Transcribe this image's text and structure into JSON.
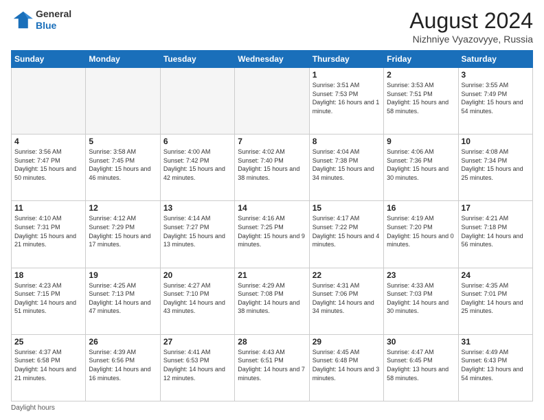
{
  "header": {
    "logo_general": "General",
    "logo_blue": "Blue",
    "month_year": "August 2024",
    "location": "Nizhniye Vyazovyye, Russia"
  },
  "days_of_week": [
    "Sunday",
    "Monday",
    "Tuesday",
    "Wednesday",
    "Thursday",
    "Friday",
    "Saturday"
  ],
  "footer": {
    "daylight_label": "Daylight hours"
  },
  "weeks": [
    [
      {
        "day": "",
        "info": ""
      },
      {
        "day": "",
        "info": ""
      },
      {
        "day": "",
        "info": ""
      },
      {
        "day": "",
        "info": ""
      },
      {
        "day": "1",
        "info": "Sunrise: 3:51 AM\nSunset: 7:53 PM\nDaylight: 16 hours\nand 1 minute."
      },
      {
        "day": "2",
        "info": "Sunrise: 3:53 AM\nSunset: 7:51 PM\nDaylight: 15 hours\nand 58 minutes."
      },
      {
        "day": "3",
        "info": "Sunrise: 3:55 AM\nSunset: 7:49 PM\nDaylight: 15 hours\nand 54 minutes."
      }
    ],
    [
      {
        "day": "4",
        "info": "Sunrise: 3:56 AM\nSunset: 7:47 PM\nDaylight: 15 hours\nand 50 minutes."
      },
      {
        "day": "5",
        "info": "Sunrise: 3:58 AM\nSunset: 7:45 PM\nDaylight: 15 hours\nand 46 minutes."
      },
      {
        "day": "6",
        "info": "Sunrise: 4:00 AM\nSunset: 7:42 PM\nDaylight: 15 hours\nand 42 minutes."
      },
      {
        "day": "7",
        "info": "Sunrise: 4:02 AM\nSunset: 7:40 PM\nDaylight: 15 hours\nand 38 minutes."
      },
      {
        "day": "8",
        "info": "Sunrise: 4:04 AM\nSunset: 7:38 PM\nDaylight: 15 hours\nand 34 minutes."
      },
      {
        "day": "9",
        "info": "Sunrise: 4:06 AM\nSunset: 7:36 PM\nDaylight: 15 hours\nand 30 minutes."
      },
      {
        "day": "10",
        "info": "Sunrise: 4:08 AM\nSunset: 7:34 PM\nDaylight: 15 hours\nand 25 minutes."
      }
    ],
    [
      {
        "day": "11",
        "info": "Sunrise: 4:10 AM\nSunset: 7:31 PM\nDaylight: 15 hours\nand 21 minutes."
      },
      {
        "day": "12",
        "info": "Sunrise: 4:12 AM\nSunset: 7:29 PM\nDaylight: 15 hours\nand 17 minutes."
      },
      {
        "day": "13",
        "info": "Sunrise: 4:14 AM\nSunset: 7:27 PM\nDaylight: 15 hours\nand 13 minutes."
      },
      {
        "day": "14",
        "info": "Sunrise: 4:16 AM\nSunset: 7:25 PM\nDaylight: 15 hours\nand 9 minutes."
      },
      {
        "day": "15",
        "info": "Sunrise: 4:17 AM\nSunset: 7:22 PM\nDaylight: 15 hours\nand 4 minutes."
      },
      {
        "day": "16",
        "info": "Sunrise: 4:19 AM\nSunset: 7:20 PM\nDaylight: 15 hours\nand 0 minutes."
      },
      {
        "day": "17",
        "info": "Sunrise: 4:21 AM\nSunset: 7:18 PM\nDaylight: 14 hours\nand 56 minutes."
      }
    ],
    [
      {
        "day": "18",
        "info": "Sunrise: 4:23 AM\nSunset: 7:15 PM\nDaylight: 14 hours\nand 51 minutes."
      },
      {
        "day": "19",
        "info": "Sunrise: 4:25 AM\nSunset: 7:13 PM\nDaylight: 14 hours\nand 47 minutes."
      },
      {
        "day": "20",
        "info": "Sunrise: 4:27 AM\nSunset: 7:10 PM\nDaylight: 14 hours\nand 43 minutes."
      },
      {
        "day": "21",
        "info": "Sunrise: 4:29 AM\nSunset: 7:08 PM\nDaylight: 14 hours\nand 38 minutes."
      },
      {
        "day": "22",
        "info": "Sunrise: 4:31 AM\nSunset: 7:06 PM\nDaylight: 14 hours\nand 34 minutes."
      },
      {
        "day": "23",
        "info": "Sunrise: 4:33 AM\nSunset: 7:03 PM\nDaylight: 14 hours\nand 30 minutes."
      },
      {
        "day": "24",
        "info": "Sunrise: 4:35 AM\nSunset: 7:01 PM\nDaylight: 14 hours\nand 25 minutes."
      }
    ],
    [
      {
        "day": "25",
        "info": "Sunrise: 4:37 AM\nSunset: 6:58 PM\nDaylight: 14 hours\nand 21 minutes."
      },
      {
        "day": "26",
        "info": "Sunrise: 4:39 AM\nSunset: 6:56 PM\nDaylight: 14 hours\nand 16 minutes."
      },
      {
        "day": "27",
        "info": "Sunrise: 4:41 AM\nSunset: 6:53 PM\nDaylight: 14 hours\nand 12 minutes."
      },
      {
        "day": "28",
        "info": "Sunrise: 4:43 AM\nSunset: 6:51 PM\nDaylight: 14 hours\nand 7 minutes."
      },
      {
        "day": "29",
        "info": "Sunrise: 4:45 AM\nSunset: 6:48 PM\nDaylight: 14 hours\nand 3 minutes."
      },
      {
        "day": "30",
        "info": "Sunrise: 4:47 AM\nSunset: 6:45 PM\nDaylight: 13 hours\nand 58 minutes."
      },
      {
        "day": "31",
        "info": "Sunrise: 4:49 AM\nSunset: 6:43 PM\nDaylight: 13 hours\nand 54 minutes."
      }
    ]
  ]
}
